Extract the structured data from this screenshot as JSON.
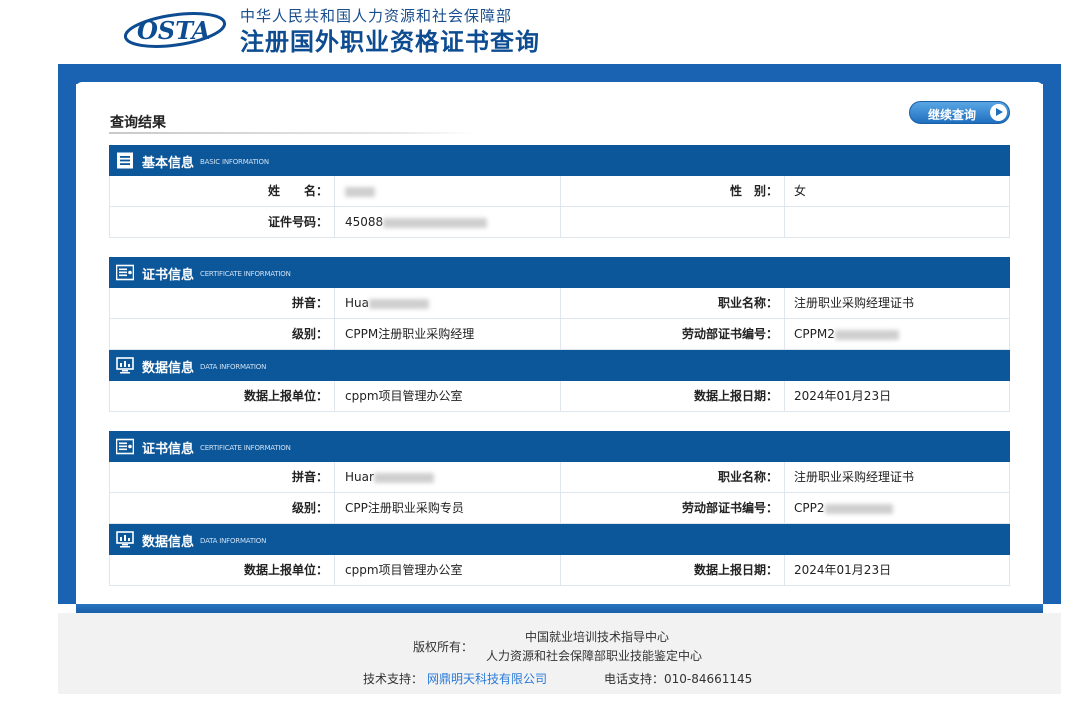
{
  "header": {
    "logo_text": "OSTA",
    "org": "中华人民共和国人力资源和社会保障部",
    "title": "注册国外职业资格证书查询"
  },
  "results": {
    "title": "查询结果",
    "continue_label": "继续查询"
  },
  "basic_info": {
    "title": "基本信息",
    "en": "BASIC INFORMATION",
    "name_label": "姓　　名：",
    "name_value": "",
    "gender_label": "性　别：",
    "gender_value": "女",
    "id_label": "证件号码：",
    "id_value": "45088"
  },
  "certificates": [
    {
      "title": "证书信息",
      "en": "CERTIFICATE INFORMATION",
      "pinyin_label": "拼音：",
      "pinyin_value": "Hua",
      "job_label": "职业名称：",
      "job_value": "注册职业采购经理证书",
      "level_label": "级别：",
      "level_value": "CPPM注册职业采购经理",
      "cert_no_label": "劳动部证书编号：",
      "cert_no_value": "CPPM2",
      "data": {
        "title": "数据信息",
        "en": "DATA INFORMATION",
        "unit_label": "数据上报单位：",
        "unit_value": "cppm项目管理办公室",
        "date_label": "数据上报日期：",
        "date_value": "2024年01月23日"
      }
    },
    {
      "title": "证书信息",
      "en": "CERTIFICATE INFORMATION",
      "pinyin_label": "拼音：",
      "pinyin_value": "Huar",
      "job_label": "职业名称：",
      "job_value": "注册职业采购经理证书",
      "level_label": "级别：",
      "level_value": "CPP注册职业采购专员",
      "cert_no_label": "劳动部证书编号：",
      "cert_no_value": "CPP2",
      "data": {
        "title": "数据信息",
        "en": "DATA INFORMATION",
        "unit_label": "数据上报单位：",
        "unit_value": "cppm项目管理办公室",
        "date_label": "数据上报日期：",
        "date_value": "2024年01月23日"
      }
    }
  ],
  "footer": {
    "copyright_label": "版权所有：",
    "org1": "中国就业培训技术指导中心",
    "org2": "人力资源和社会保障部职业技能鉴定中心",
    "tech_label": "技术支持：",
    "tech_link": "网鼎明天科技有限公司",
    "phone": "电话支持：010-84661145"
  },
  "colors": {
    "brand_blue": "#0c5799",
    "bar_blue": "#1a63b2",
    "link_blue": "#2a7ad8"
  }
}
